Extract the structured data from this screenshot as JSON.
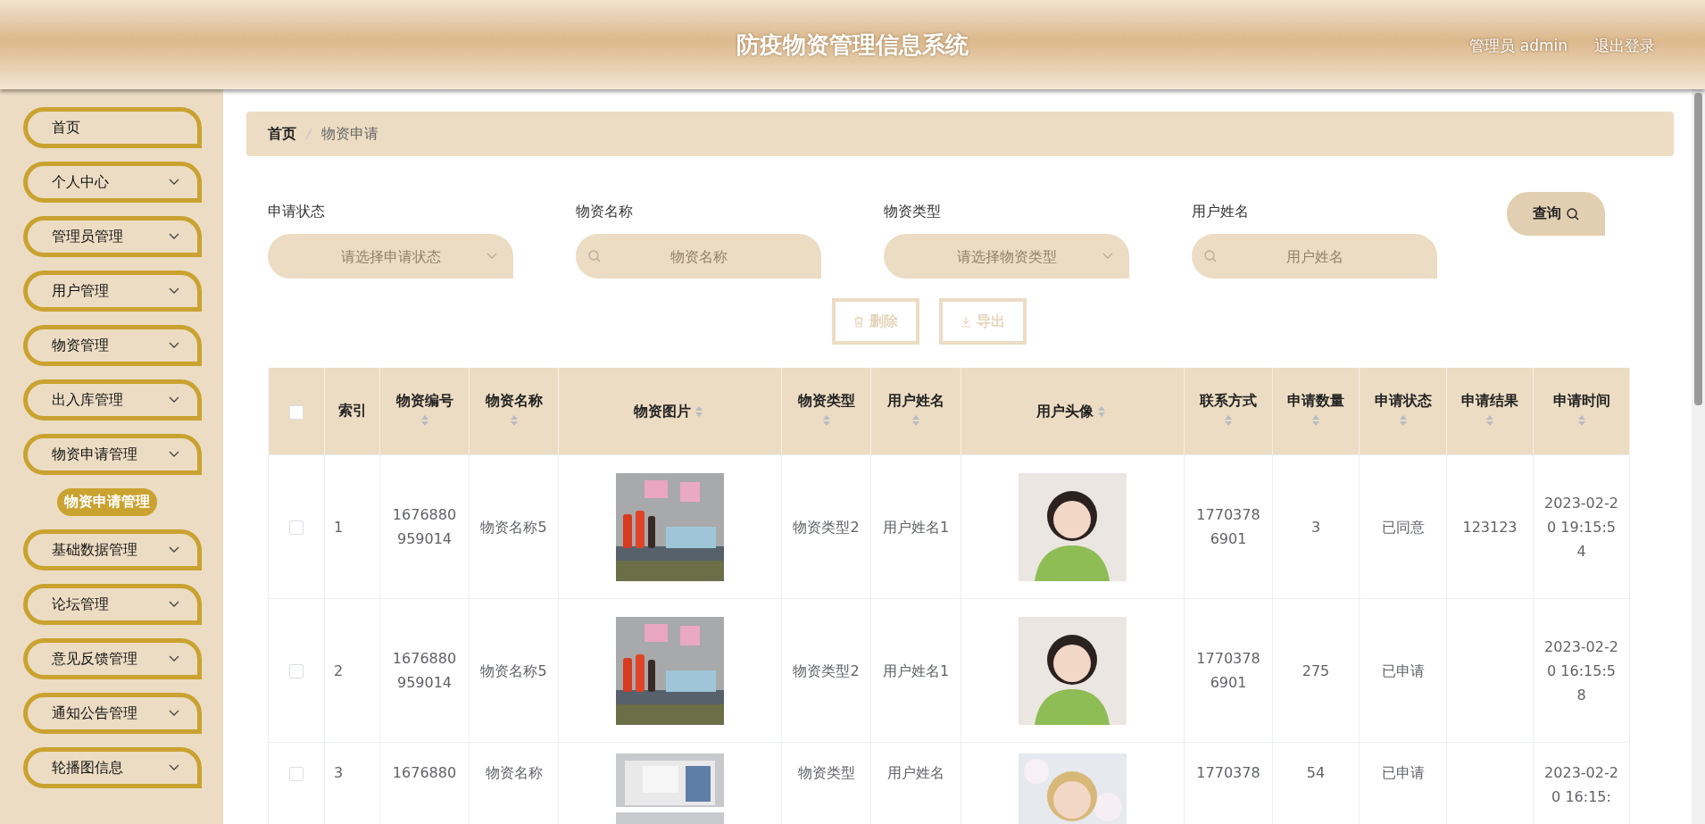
{
  "header": {
    "title": "防疫物资管理信息系统",
    "user": "管理员 admin",
    "logout": "退出登录"
  },
  "sidebar": {
    "items": [
      {
        "label": "首页",
        "kind": "link"
      },
      {
        "label": "个人中心",
        "kind": "submenu"
      },
      {
        "label": "管理员管理",
        "kind": "submenu"
      },
      {
        "label": "用户管理",
        "kind": "submenu"
      },
      {
        "label": "物资管理",
        "kind": "submenu"
      },
      {
        "label": "出入库管理",
        "kind": "submenu"
      },
      {
        "label": "物资申请管理",
        "kind": "submenu",
        "children": [
          {
            "label": "物资申请管理",
            "selected": true
          }
        ]
      },
      {
        "label": "基础数据管理",
        "kind": "submenu"
      },
      {
        "label": "论坛管理",
        "kind": "submenu"
      },
      {
        "label": "意见反馈管理",
        "kind": "submenu"
      },
      {
        "label": "通知公告管理",
        "kind": "submenu"
      },
      {
        "label": "轮播图信息",
        "kind": "submenu"
      }
    ]
  },
  "breadcrumb": [
    "首页",
    "物资申请"
  ],
  "filters": [
    {
      "label": "申请状态",
      "kind": "select",
      "placeholder": "请选择申请状态"
    },
    {
      "label": "物资名称",
      "kind": "search",
      "placeholder": "物资名称"
    },
    {
      "label": "物资类型",
      "kind": "select",
      "placeholder": "请选择物资类型"
    },
    {
      "label": "用户姓名",
      "kind": "search",
      "placeholder": "用户姓名"
    }
  ],
  "query_button": "查询",
  "actions": [
    {
      "label": "删除",
      "kind": "delete",
      "disabled": true
    },
    {
      "label": "导出",
      "kind": "export",
      "disabled": true
    }
  ],
  "table": {
    "header_checked": false,
    "columns": [
      {
        "label": "索引",
        "sortable": false
      },
      {
        "label": "物资编号",
        "sortable": true
      },
      {
        "label": "物资名称",
        "sortable": true
      },
      {
        "label": "物资图片",
        "sortable": true
      },
      {
        "label": "物资类型",
        "sortable": true
      },
      {
        "label": "用户姓名",
        "sortable": true
      },
      {
        "label": "用户头像",
        "sortable": true
      },
      {
        "label": "联系方式",
        "sortable": true
      },
      {
        "label": "申请数量",
        "sortable": true
      },
      {
        "label": "申请状态",
        "sortable": true
      },
      {
        "label": "申请结果",
        "sortable": true
      },
      {
        "label": "申请时间",
        "sortable": true
      }
    ],
    "rows": [
      {
        "checked": false,
        "cells": [
          "1",
          "1676880959014",
          "物资名称5",
          {
            "kind": "picture"
          },
          "物资类型2",
          "用户姓名1",
          {
            "kind": "picture"
          },
          "17703786901",
          "3",
          "已同意",
          "123123",
          "2023-02-20 19:15:54"
        ]
      },
      {
        "checked": false,
        "cells": [
          "2",
          "1676880959014",
          "物资名称5",
          {
            "kind": "picture"
          },
          "物资类型2",
          "用户姓名1",
          {
            "kind": "picture"
          },
          "17703786901",
          "275",
          "已申请",
          "",
          "2023-02-20 16:15:58"
        ]
      },
      {
        "checked": false,
        "cells": [
          "3",
          "1676880",
          "物资名称",
          {
            "kind": "picture"
          },
          "物资类型",
          "用户姓名",
          {
            "kind": "picture"
          },
          "1770378",
          "54",
          "已申请",
          "",
          "2023-02-20 16:15:"
        ]
      }
    ]
  }
}
